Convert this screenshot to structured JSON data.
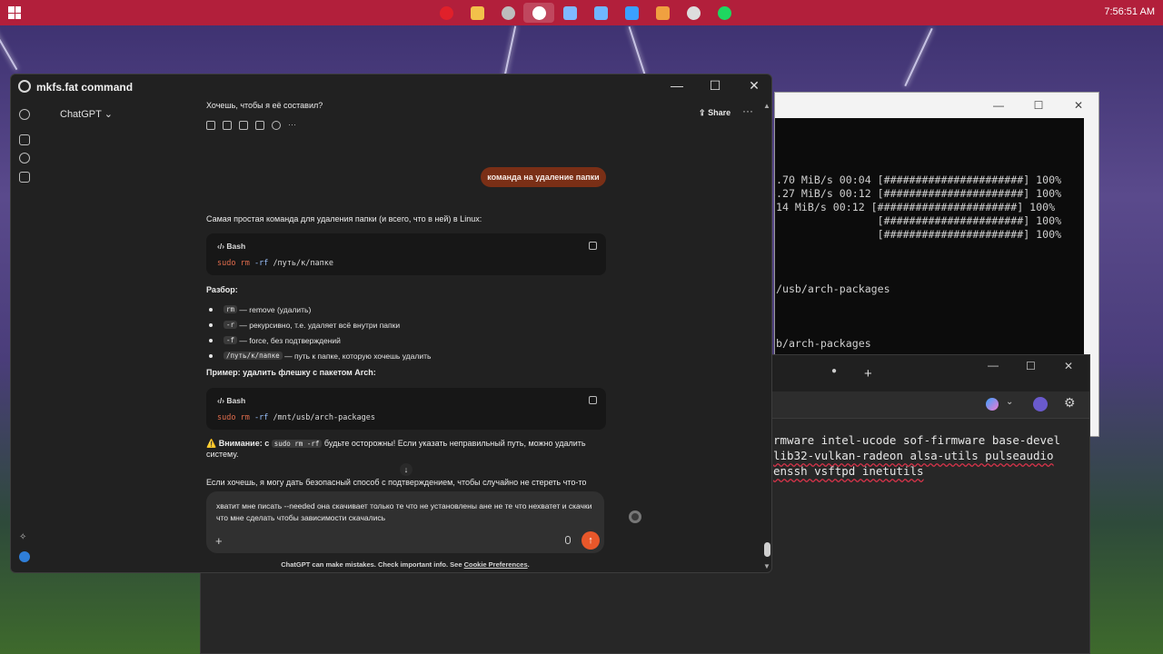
{
  "taskbar": {
    "clock": "7:56:51 AM",
    "icons": [
      {
        "name": "opera-icon",
        "color": "#e0202a"
      },
      {
        "name": "file-explorer-icon",
        "color": "#f2c14a"
      },
      {
        "name": "obs-icon",
        "color": "#bdbdbd"
      },
      {
        "name": "chatgpt-icon",
        "color": "#ffffff"
      },
      {
        "name": "app-icon",
        "color": "#7fb8ff"
      },
      {
        "name": "notepad-icon",
        "color": "#6fb6ff"
      },
      {
        "name": "vscode-like-icon",
        "color": "#3aa0ff"
      },
      {
        "name": "capture-icon",
        "color": "#f0a040"
      },
      {
        "name": "steam-like-icon",
        "color": "#dddddd"
      },
      {
        "name": "spotify-icon",
        "color": "#1ed760"
      }
    ]
  },
  "terminal": {
    "lines": [
      "2.70 MiB/s 00:04 [######################] 100%",
      "3.27 MiB/s 00:12 [######################] 100%",
      ".14 MiB/s 00:12 [######################] 100%",
      "                 [######################] 100%",
      "                 [######################] 100%",
      "c/usb/arch-packages",
      "sb/arch-packages"
    ]
  },
  "browser": {
    "lines": [
      "rmware intel-ucode sof-firmware base-devel",
      "lib32-vulkan-radeon alsa-utils pulseaudio",
      "enssh vsftpd inetutils"
    ]
  },
  "gpt": {
    "window_title": "mkfs.fat command",
    "model": "ChatGPT",
    "share": "Share",
    "prev_message": "Хочешь, чтобы я её составил?",
    "user_message": "команда на удаление  папки",
    "intro": "Самая простая команда для удаления папки (и всего, что в ней) в Linux:",
    "code1": {
      "lang": "Bash",
      "kw": "sudo rm",
      "flag": "-rf",
      "path": "/путь/к/папке"
    },
    "breakdown_title": "Разбор:",
    "bullets": [
      {
        "code": "rm",
        "text": "— remove (удалить)"
      },
      {
        "code": "-r",
        "text": "— рекурсивно, т.е. удаляет всё внутри папки"
      },
      {
        "code": "-f",
        "text": "— force, без подтверждений"
      },
      {
        "code": "/путь/к/папке",
        "text": "— путь к папке, которую хочешь удалить"
      }
    ],
    "example_title": "Пример: удалить флешку с пакетом Arch:",
    "code2": {
      "lang": "Bash",
      "kw": "sudo rm",
      "flag": "-rf",
      "path": "/mnt/usb/arch-packages"
    },
    "warning_prefix": "⚠️ Внимание: с",
    "warning_code": "sudo rm -rf",
    "warning_rest": "будьте осторожны! Если указать неправильный путь, можно удалить",
    "warning_end": "систему.",
    "offer": "Если хочешь, я могу дать безопасный способ с подтверждением, чтобы случайно не стереть что-то",
    "composer_text": "хватит мне писать --needed она скачивает только те что не установлены  ане не те что нехватет и скачки что мне сделать чтобы зависимости скачались",
    "footer_prefix": "ChatGPT can make mistakes. Check important info. See",
    "footer_link": "Cookie Preferences",
    "footer_suffix": "."
  }
}
